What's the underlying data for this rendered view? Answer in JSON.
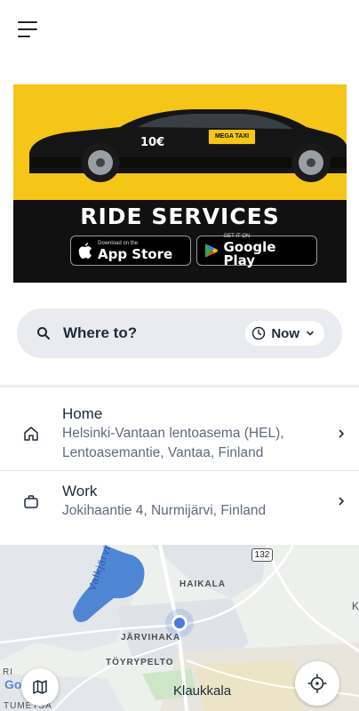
{
  "header": {
    "menu_icon": "hamburger-menu-icon"
  },
  "banner": {
    "price": "10€",
    "taxi_sign": "MEGA TAXI",
    "title": "RIDE SERVICES",
    "app_store": {
      "small": "Download on the",
      "big": "App Store"
    },
    "google_play": {
      "small": "GET IT ON",
      "big": "Google Play"
    },
    "colors": {
      "yellow": "#f5c518",
      "black": "#111111"
    }
  },
  "search": {
    "placeholder": "Where to?",
    "time_label": "Now"
  },
  "saved_places": [
    {
      "title": "Home",
      "address_line1": "Helsinki-Vantaan lentoasema (HEL),",
      "address_line2": "Lentoasemantie, Vantaa, Finland",
      "icon": "home-icon"
    },
    {
      "title": "Work",
      "address": "Jokihaantie 4, Nurmijärvi, Finland",
      "icon": "briefcase-icon"
    }
  ],
  "map": {
    "labels": {
      "lake": "Valkjärvi",
      "route": "132",
      "haikala": "HAIKALA",
      "jarvihaka": "JÄRVIHAKA",
      "toyrypelto": "TÖYRYPELTO",
      "klaukkala": "Klaukkala",
      "tumetsa": "TUMETSÄ",
      "edge_left": "RI",
      "edge_right": "K",
      "google": "Go"
    },
    "colors": {
      "water": "#4f86d4",
      "park": "#cfe5c8",
      "road": "#ffffff"
    }
  }
}
